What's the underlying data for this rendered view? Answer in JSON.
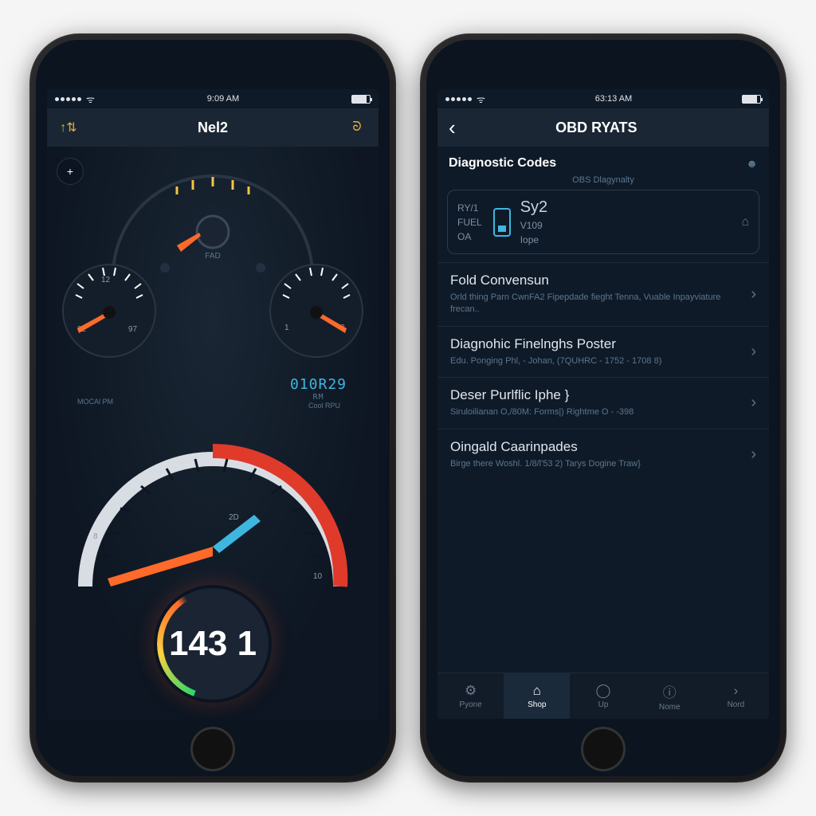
{
  "left": {
    "status_time": "9:09 AM",
    "nav_title": "Nel2",
    "btn_plus": "+",
    "fad_label": "FAD",
    "gauge_left": {
      "ticks": [
        "02",
        "12",
        "97"
      ],
      "label": "MOCAl PM"
    },
    "gauge_right": {
      "ticks": [
        "1",
        "8"
      ],
      "label": "Cool RPU"
    },
    "digital": "010R29",
    "digital_sub": "RM",
    "big_gauge": {
      "ticks": [
        "8",
        "2D",
        "10"
      ]
    },
    "speed": "143 1"
  },
  "right": {
    "status_time": "63:13 AM",
    "nav_title": "OBD RYATS",
    "section": "Diagnostic Codes",
    "obs_sub": "OBS Dlagynalty",
    "card": {
      "left_lines": [
        "RY/1",
        "FUEL",
        "OA"
      ],
      "mid_big": "Sy2",
      "mid_lines": [
        "V109",
        "Iope"
      ]
    },
    "rows": [
      {
        "title": "Fold Convensun",
        "sub": "Orld thing Parn CwnFA2\nFipepdade fieght Tenna, Vuable Inpayviature frecan.."
      },
      {
        "title": "Diagnohic Finelnghs Poster",
        "sub": "Edu. Ponging\nPhl, - Johan, (7QUHRC - 1752 - 1708 8)"
      },
      {
        "title": "Deser Purlflic Iphe }",
        "sub": "Siruloilianan O,/80M: Forms|)\nRightme O - -398"
      },
      {
        "title": "Oingald Caarinpades",
        "sub": "Birge there Woshl. 1/8/l'53 2) Tarys\nDogine Traw}"
      }
    ],
    "tabs": [
      {
        "label": "Pyone"
      },
      {
        "label": "Shop",
        "active": true
      },
      {
        "label": "Up"
      },
      {
        "label": "Nome"
      },
      {
        "label": "Nord"
      }
    ]
  }
}
